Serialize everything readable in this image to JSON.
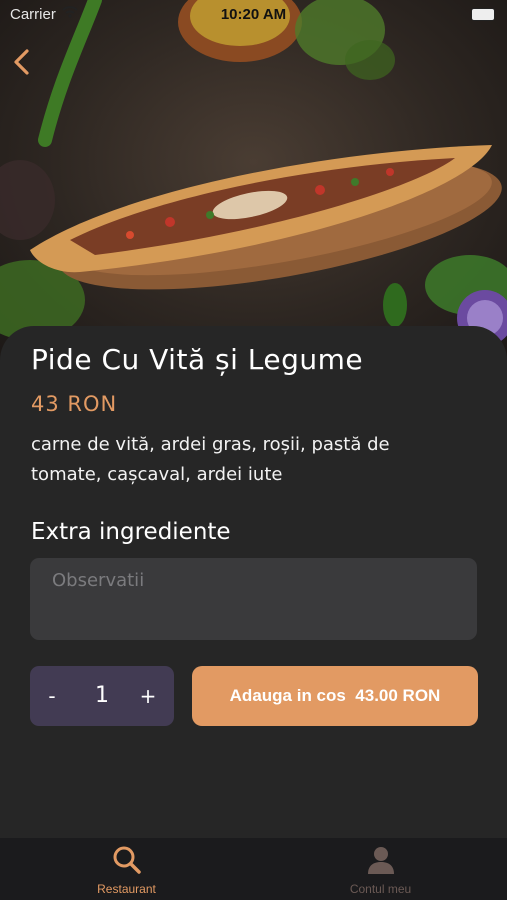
{
  "status_bar": {
    "carrier": "Carrier",
    "time": "10:20 AM"
  },
  "product": {
    "title": "Pide Cu Vită și Legume",
    "price": "43 RON",
    "description": "carne de vită, ardei gras, roșii, pastă de tomate, cașcaval, ardei iute"
  },
  "extras": {
    "heading": "Extra ingrediente",
    "notes_placeholder": "Observatii"
  },
  "cart": {
    "minus_label": "-",
    "quantity": "1",
    "plus_label": "+",
    "add_button_label": "Adauga in cos  43.00 RON"
  },
  "tabs": [
    {
      "label": "Restaurant",
      "icon": "search-icon",
      "active": true
    },
    {
      "label": "Contul meu",
      "icon": "user-icon",
      "active": false
    }
  ],
  "colors": {
    "accent": "#e29a63",
    "sheet": "#262626",
    "stepper": "#423b53",
    "field": "#3a3a3c",
    "tabbar": "#1b1b1d"
  }
}
